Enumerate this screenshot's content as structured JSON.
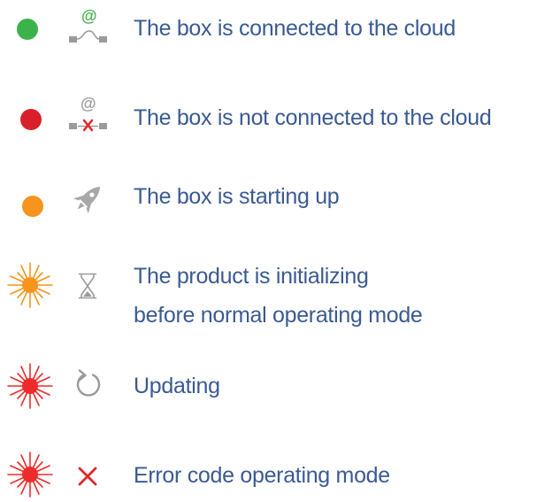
{
  "legend": {
    "items": [
      {
        "indicator": "steady-led",
        "led_color": "#3cb24a",
        "icon": "cloud-connected-icon",
        "lines": [
          "The box is connected to the cloud"
        ]
      },
      {
        "indicator": "steady-led",
        "led_color": "#d8202a",
        "icon": "cloud-disconnected-icon",
        "lines": [
          "The box is not connected to the cloud"
        ]
      },
      {
        "indicator": "steady-led",
        "led_color": "#f7941d",
        "icon": "rocket-icon",
        "lines": [
          "The box is starting up"
        ]
      },
      {
        "indicator": "blinking-led",
        "led_color": "#f7941d",
        "icon": "hourglass-icon",
        "lines": [
          "The product is initializing",
          "before normal operating mode"
        ]
      },
      {
        "indicator": "blinking-led",
        "led_color": "#ee2b2b",
        "icon": "refresh-icon",
        "lines": [
          "Updating"
        ]
      },
      {
        "indicator": "blinking-led",
        "led_color": "#ee2b2b",
        "icon": "error-x-icon",
        "lines": [
          "Error code operating mode"
        ]
      }
    ]
  }
}
